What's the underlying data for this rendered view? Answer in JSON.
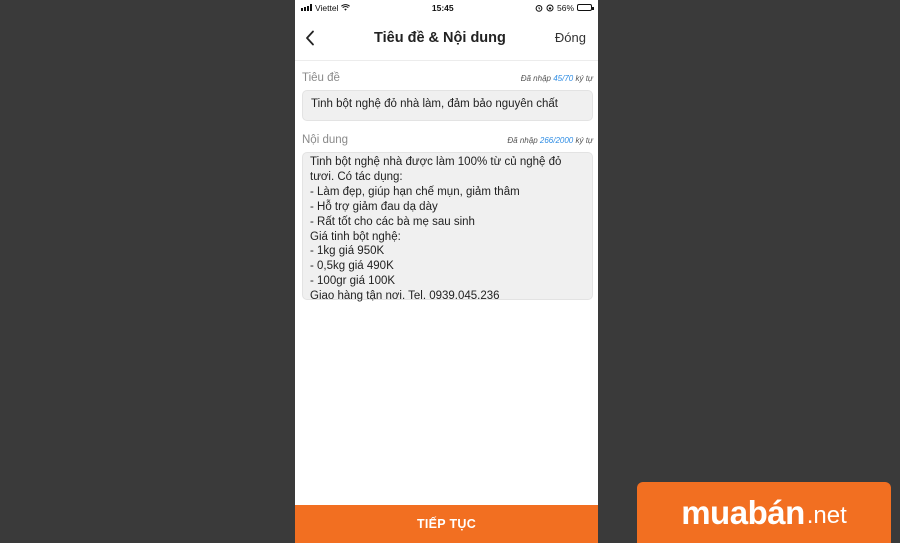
{
  "status_bar": {
    "carrier": "Viettel",
    "time": "15:45",
    "battery": "56%",
    "battery_level": 0.56
  },
  "nav": {
    "title": "Tiêu đề & Nội dung",
    "close_label": "Đóng",
    "back_icon": "chevron-left-icon"
  },
  "title_field": {
    "label": "Tiêu đề",
    "counter_prefix": "Đã nhập",
    "counter_value": "45/70",
    "counter_suffix": "ký tự",
    "value": "Tinh bột nghệ đỏ nhà làm, đảm bảo nguyên chất"
  },
  "content_field": {
    "label": "Nội dung",
    "counter_prefix": "Đã nhập",
    "counter_value": "266/2000",
    "counter_suffix": "ký tự",
    "lines": [
      "Tinh bột nghệ nhà được làm 100% từ củ nghệ đỏ",
      "tươi. Có tác dụng:",
      "- Làm đẹp, giúp hạn chế mụn, giảm thâm",
      "- Hỗ trợ giảm đau dạ dày",
      "- Rất tốt cho các bà mẹ sau sinh",
      "Giá tinh bột nghệ:",
      "- 1kg giá 950K",
      "- 0,5kg giá 490K",
      "- 100gr giá 100K",
      "Giao hàng tận nơi. Tel. 0939.045.236"
    ]
  },
  "next_button_label": "TIẾP TỤC",
  "brand": {
    "name": "muabán",
    "tld": ".net",
    "color": "#f26f21"
  }
}
